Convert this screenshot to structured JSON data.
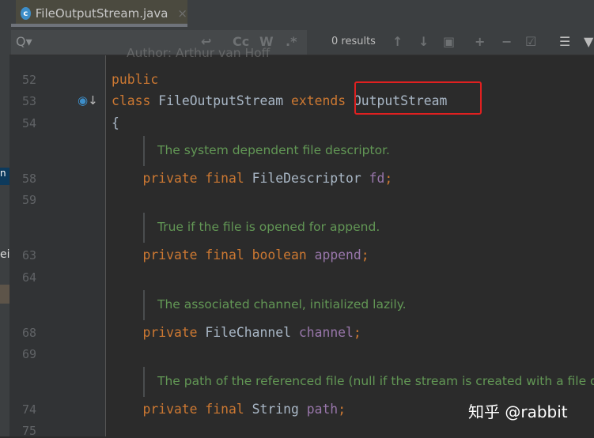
{
  "tab": {
    "icon": "java-class-icon",
    "filename": "FileOutputStream.java",
    "close": "×"
  },
  "search": {
    "placeholder_icon": "Q▾",
    "results": "0 results",
    "buttons": [
      "↩",
      "Cc",
      "W",
      ".*",
      "↑",
      "↓",
      "▣",
      "+",
      "−",
      "☑",
      "☰",
      "▼"
    ]
  },
  "lines": [
    {
      "n": "52",
      "code": [
        {
          "t": "public",
          "c": "kw"
        }
      ]
    },
    {
      "n": "53",
      "code": [
        {
          "t": "class ",
          "c": "kw"
        },
        {
          "t": "FileOutputStream ",
          "c": ""
        },
        {
          "t": "extends ",
          "c": "kw"
        },
        {
          "t": "OutputStream",
          "c": ""
        }
      ]
    },
    {
      "n": "54",
      "code": [
        {
          "t": "{",
          "c": ""
        }
      ]
    },
    {
      "n": "58",
      "code": [
        {
          "t": "    private final ",
          "c": "kw"
        },
        {
          "t": "FileDescriptor ",
          "c": ""
        },
        {
          "t": "fd",
          "c": "fld"
        },
        {
          "t": ";",
          "c": "kw"
        }
      ]
    },
    {
      "n": "59",
      "code": []
    },
    {
      "n": "63",
      "code": [
        {
          "t": "    private final boolean ",
          "c": "kw"
        },
        {
          "t": "append",
          "c": "fld"
        },
        {
          "t": ";",
          "c": "kw"
        }
      ]
    },
    {
      "n": "64",
      "code": []
    },
    {
      "n": "68",
      "code": [
        {
          "t": "    private ",
          "c": "kw"
        },
        {
          "t": "FileChannel ",
          "c": ""
        },
        {
          "t": "channel",
          "c": "fld"
        },
        {
          "t": ";",
          "c": "kw"
        }
      ]
    },
    {
      "n": "69",
      "code": []
    },
    {
      "n": "74",
      "code": [
        {
          "t": "    private final ",
          "c": "kw"
        },
        {
          "t": "String ",
          "c": ""
        },
        {
          "t": "path",
          "c": "fld"
        },
        {
          "t": ";",
          "c": "kw"
        }
      ]
    },
    {
      "n": "75",
      "code": []
    }
  ],
  "author_line": "Author: Arthur van Hoff",
  "docs": [
    "The system dependent file descriptor.",
    "True if the file is opened for append.",
    "The associated channel, initialized lazily.",
    "The path of the referenced file (null if the stream is created with a file de"
  ],
  "side_text": "ei",
  "watermark": "知乎 @rabbit"
}
